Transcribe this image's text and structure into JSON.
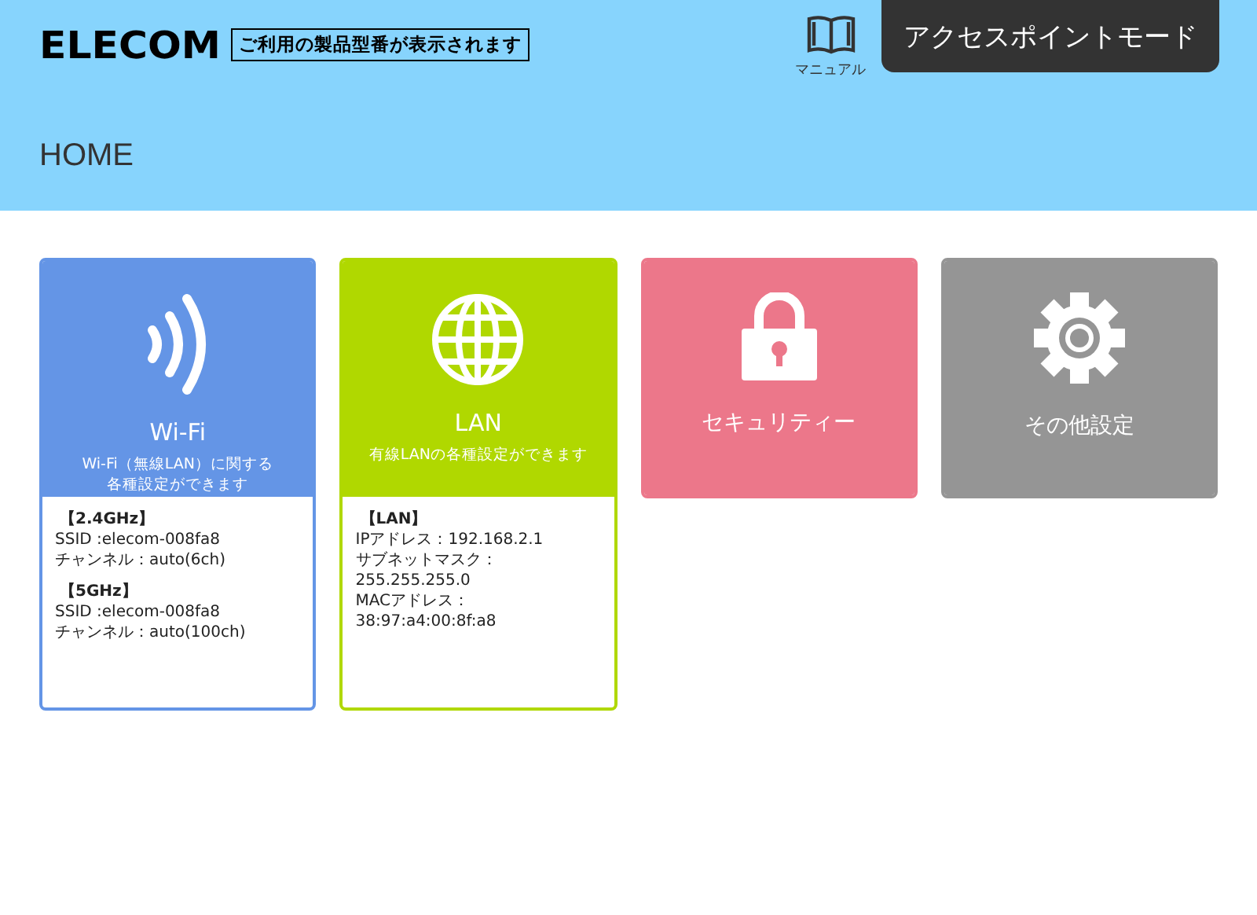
{
  "header": {
    "logo": "ELECOM",
    "model_note": "ご利用の製品型番が表示されます",
    "manual": "マニュアル",
    "mode_button": "アクセスポイントモード"
  },
  "page_title": "HOME",
  "tiles": [
    {
      "kind": "wifi",
      "title": "Wi-Fi",
      "subtitle": [
        "Wi-Fi（無線LAN）に関する",
        "各種設定ができます"
      ],
      "color": "#6495e6",
      "info": [
        {
          "heading": "【2.4GHz】",
          "lines": [
            "SSID :elecom-008fa8",
            "チャンネル：auto(6ch)"
          ]
        },
        {
          "heading": "【5GHz】",
          "lines": [
            "SSID :elecom-008fa8",
            "チャンネル：auto(100ch)"
          ]
        }
      ]
    },
    {
      "kind": "lan",
      "title": "LAN",
      "subtitle": [
        "有線LANの各種設定ができます"
      ],
      "color": "#b0d800",
      "info": [
        {
          "heading": "【LAN】",
          "lines": [
            "IPアドレス：192.168.2.1",
            "サブネットマスク：\n255.255.255.0",
            "MACアドレス：\n38:97:a4:00:8f:a8"
          ]
        }
      ]
    },
    {
      "kind": "security",
      "title": "セキュリティー",
      "color": "#ec778a"
    },
    {
      "kind": "other",
      "title": "その他設定",
      "color": "#959595"
    }
  ]
}
